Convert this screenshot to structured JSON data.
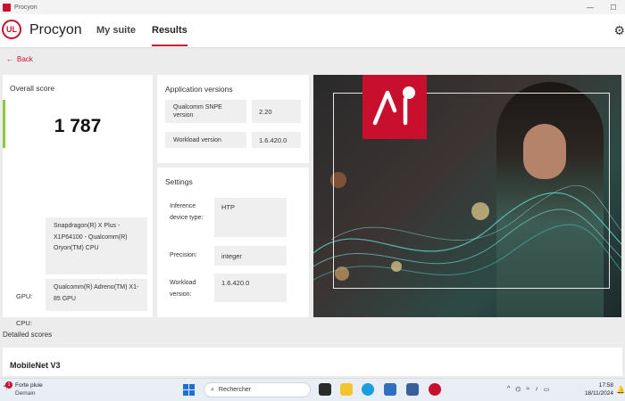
{
  "window": {
    "title": "Procyon",
    "controls": [
      "—",
      "☐"
    ]
  },
  "header": {
    "logo_text": "UL",
    "brand": "Procyon",
    "nav": [
      {
        "label": "My suite"
      },
      {
        "label": "Results"
      }
    ]
  },
  "back_label": "Back",
  "overall": {
    "label": "Overall score",
    "score": "1 787",
    "cpu_label": "CPU:",
    "cpu_value": "Snapdragon(R) X Plus - X1P64100 - Qualcomm(R) Oryon(TM) CPU",
    "gpu_label": "GPU:",
    "gpu_value": "Qualcomm(R) Adreno(TM) X1-85 GPU"
  },
  "app_versions": {
    "title": "Application versions",
    "rows": [
      {
        "key": "Qualcomm SNPE version",
        "value": "2.20"
      },
      {
        "key": "Workload version",
        "value": "1.6.420.0"
      }
    ]
  },
  "settings": {
    "title": "Settings",
    "rows": [
      {
        "key": "Inference device type:",
        "value": "HTP"
      },
      {
        "key": "Precision:",
        "value": "integer"
      },
      {
        "key": "Workload version:",
        "value": "1.6.420.0"
      }
    ]
  },
  "hero": {
    "badge_text": "AI",
    "accent": "#c8102e"
  },
  "detailed_scores": {
    "label": "Detailed scores",
    "first_item": "MobileNet V3"
  },
  "taskbar": {
    "weather_badge": "1",
    "weather_line1": "Forte pluie",
    "weather_line2": "Demain",
    "search_placeholder": "Rechercher",
    "time": "17:58",
    "date": "18/11/2024"
  },
  "colors": {
    "accent": "#c8102e",
    "score_bar": "#8dc63f"
  }
}
